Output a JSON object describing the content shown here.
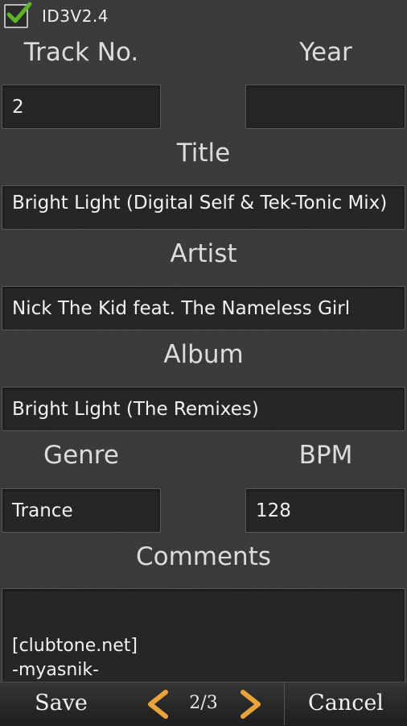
{
  "header": {
    "tag_version_checked": true,
    "tag_version_label": "ID3V2.4"
  },
  "fields": {
    "track_no": {
      "label": "Track No.",
      "value": "2"
    },
    "year": {
      "label": "Year",
      "value": ""
    },
    "title": {
      "label": "Title",
      "value": "Bright Light (Digital Self & Tek-Tonic Mix)"
    },
    "artist": {
      "label": "Artist",
      "value": "Nick The Kid feat. The Nameless Girl"
    },
    "album": {
      "label": "Album",
      "value": "Bright Light (The Remixes)"
    },
    "genre": {
      "label": "Genre",
      "value": "Trance"
    },
    "bpm": {
      "label": "BPM",
      "value": "128"
    },
    "comments": {
      "label": "Comments",
      "lines": [
        "[clubtone.net]",
        "-myasnik-"
      ]
    }
  },
  "bottom_bar": {
    "save_label": "Save",
    "page_indicator": "2/3",
    "cancel_label": "Cancel"
  },
  "colors": {
    "background": "#3a3a3a",
    "field_background": "#262626",
    "checkmark": "#5fb32c",
    "arrow": "#e8a33a"
  }
}
